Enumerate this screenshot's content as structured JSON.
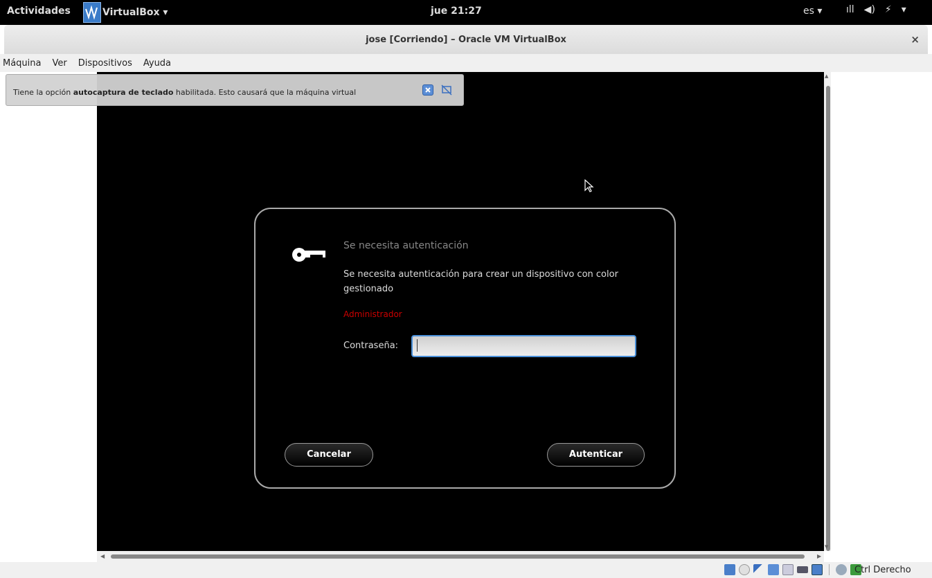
{
  "topbar": {
    "activities": "Actividades",
    "app_name": "VirtualBox ▾",
    "clock": "jue 21:27",
    "lang": "es ▾",
    "tray_icons": [
      "signal-icon",
      "volume-icon",
      "battery-icon",
      "dropdown-icon"
    ],
    "tray_glyphs": [
      "ıll",
      "◀)",
      "⚡",
      "▾"
    ]
  },
  "window": {
    "title": "jose [Corriendo] – Oracle VM VirtualBox",
    "close": "×"
  },
  "menubar": [
    "Máquina",
    "Ver",
    "Dispositivos",
    "Ayuda"
  ],
  "notice": {
    "text_before": "Tiene la opción ",
    "text_bold": "autocaptura de teclado",
    "text_after": " habilitada. Esto causará que la máquina virtual"
  },
  "dialog": {
    "title": "Se necesita autenticación",
    "body": "Se necesita autenticación para crear un dispositivo con color gestionado",
    "user": "Administrador",
    "password_label": "Contraseña:",
    "password_value": "",
    "cancel_label": "Cancelar",
    "ok_label": "Autenticar"
  },
  "statusbar": {
    "host_key": "Ctrl Derecho",
    "icons": [
      "hard-disk-icon",
      "optical-drive-icon",
      "usb-icon",
      "shared-folders-icon",
      "display-icon",
      "network-icon",
      "video-capture-icon",
      "mouse-integration-icon",
      "keyboard-capture-icon"
    ]
  },
  "colors": {
    "accent": "#4a90d9",
    "admin_red": "#cc0000",
    "vm_background": "#000000"
  }
}
